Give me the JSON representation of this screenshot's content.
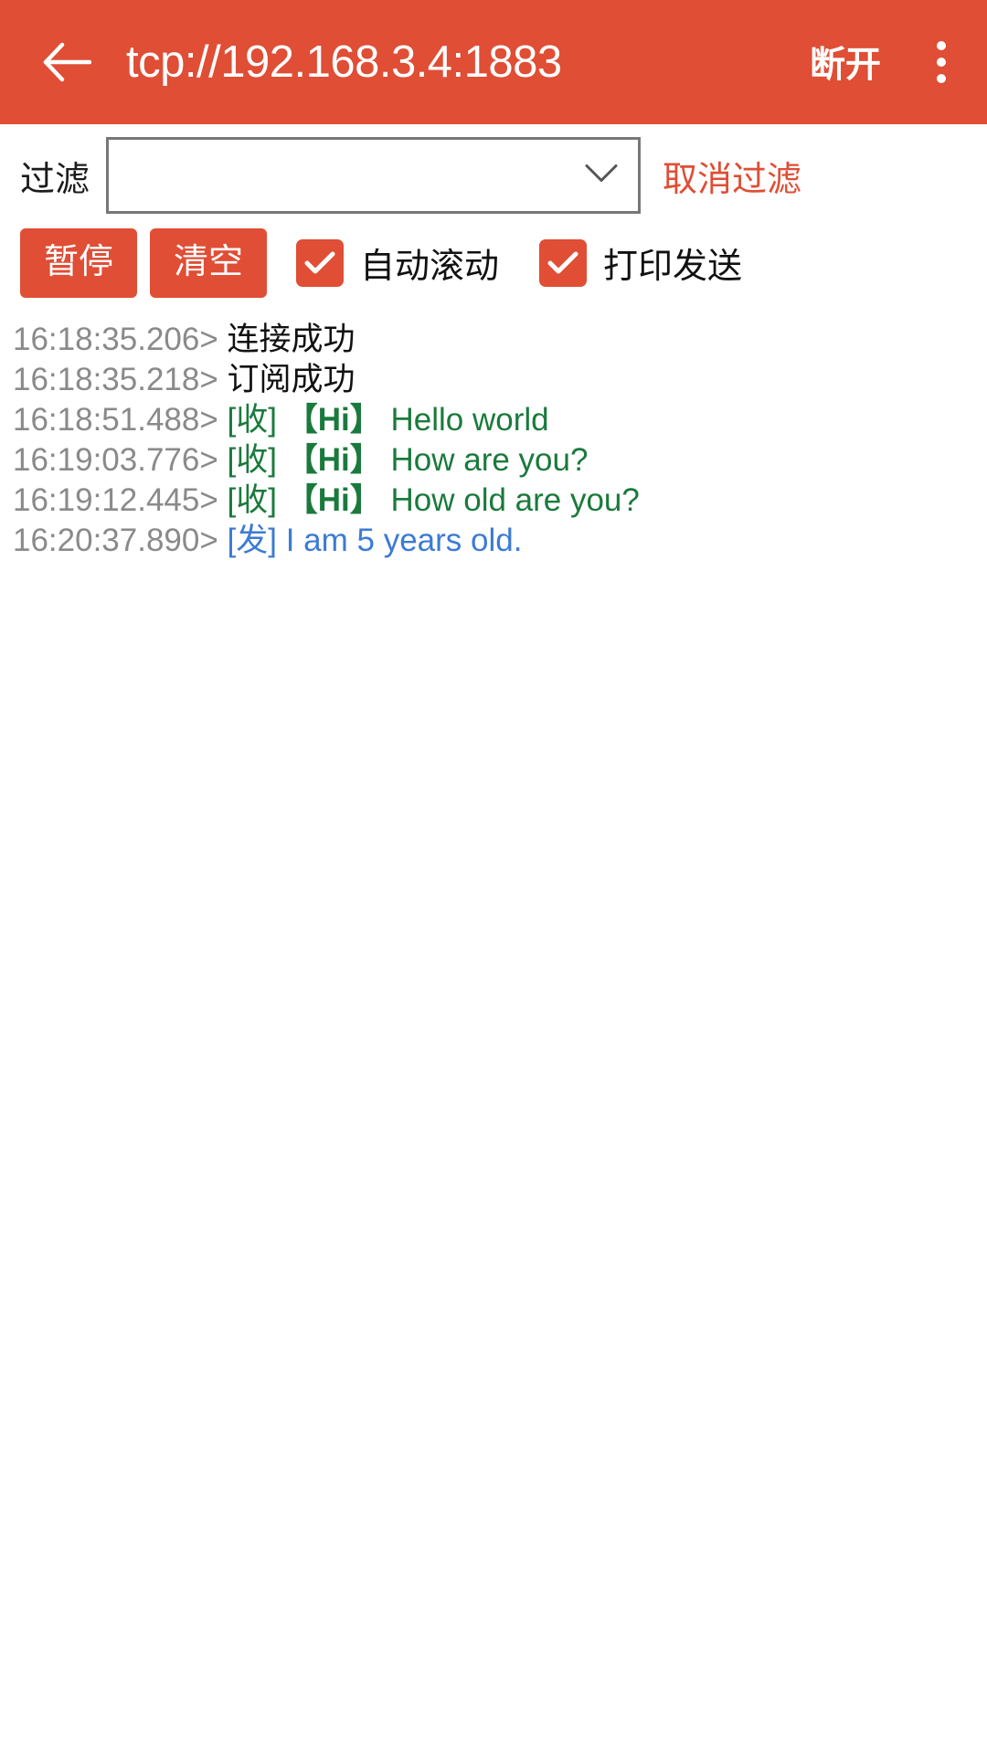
{
  "appbar": {
    "back_icon": "arrow-left-icon",
    "title": "tcp://192.168.3.4:1883",
    "action_label": "断开",
    "overflow_icon": "more-vertical-icon",
    "background": "#DF4E35"
  },
  "filter": {
    "label": "过滤",
    "value": "",
    "placeholder": "",
    "chevron_icon": "chevron-down-icon",
    "cancel_label": "取消过滤",
    "cancel_color": "#DF4E35"
  },
  "controls": {
    "pause_label": "暂停",
    "clear_label": "清空",
    "autoscroll": {
      "label": "自动滚动",
      "checked": true
    },
    "printsend": {
      "label": "打印发送",
      "checked": true
    },
    "accent": "#DF4E35"
  },
  "log": {
    "ts_color": "#8a8a8a",
    "recv_color": "#1a7a3c",
    "send_color": "#3c7bd4",
    "info_color": "#111111",
    "lines": [
      {
        "ts": "16:18:35.206>",
        "kind": "info",
        "tag": "",
        "topic": "",
        "text": "连接成功"
      },
      {
        "ts": "16:18:35.218>",
        "kind": "info",
        "tag": "",
        "topic": "",
        "text": "订阅成功"
      },
      {
        "ts": "16:18:51.488>",
        "kind": "recv",
        "tag": "[收]",
        "topic": "【Hi】",
        "text": "Hello world"
      },
      {
        "ts": "16:19:03.776>",
        "kind": "recv",
        "tag": "[收]",
        "topic": "【Hi】",
        "text": "How are you?"
      },
      {
        "ts": "16:19:12.445>",
        "kind": "recv",
        "tag": "[收]",
        "topic": "【Hi】",
        "text": "How old are you?"
      },
      {
        "ts": "16:20:37.890>",
        "kind": "send",
        "tag": "[发]",
        "topic": "",
        "text": "I am 5 years old."
      }
    ]
  }
}
